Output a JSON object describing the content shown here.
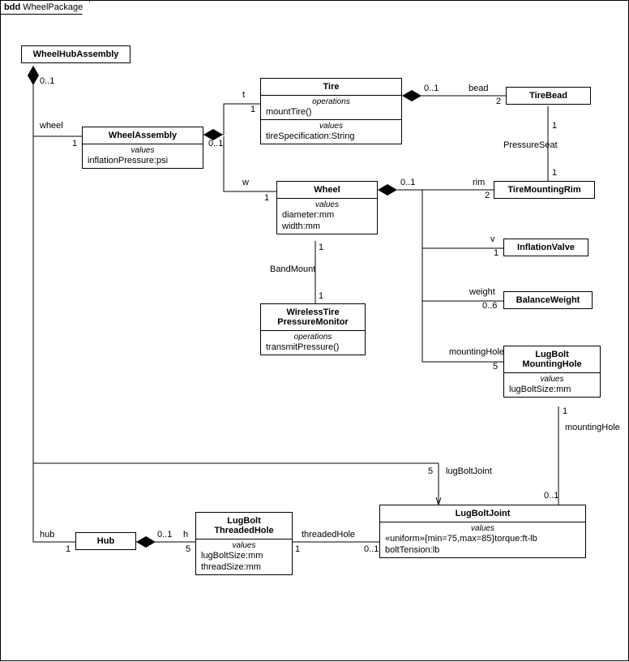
{
  "frame": {
    "prefix": "bdd",
    "name": "WheelPackage"
  },
  "blocks": {
    "wheelHubAssembly": {
      "title": "WheelHubAssembly"
    },
    "wheelAssembly": {
      "title": "WheelAssembly",
      "valuesCaption": "values",
      "values": [
        "inflationPressure:psi"
      ]
    },
    "tire": {
      "title": "Tire",
      "opsCaption": "operations",
      "ops": [
        "mountTire()"
      ],
      "valuesCaption": "values",
      "values": [
        "tireSpecification:String"
      ]
    },
    "tireBead": {
      "title": "TireBead"
    },
    "wheel": {
      "title": "Wheel",
      "valuesCaption": "values",
      "values": [
        "diameter:mm",
        "width:mm"
      ]
    },
    "tireMountingRim": {
      "title": "TireMountingRim"
    },
    "inflationValve": {
      "title": "InflationValve"
    },
    "balanceWeight": {
      "title": "BalanceWeight"
    },
    "wirelessMonitor": {
      "title": "WirelessTire\nPressureMonitor",
      "opsCaption": "operations",
      "ops": [
        "transmitPressure()"
      ]
    },
    "lugBoltMountingHole": {
      "title": "LugBolt\nMountingHole",
      "valuesCaption": "values",
      "values": [
        "lugBoltSize:mm"
      ]
    },
    "hub": {
      "title": "Hub"
    },
    "lugBoltThreadedHole": {
      "title": "LugBolt\nThreadedHole",
      "valuesCaption": "values",
      "values": [
        "lugBoltSize:mm",
        "threadSize:mm"
      ]
    },
    "lugBoltJoint": {
      "title": "LugBoltJoint",
      "valuesCaption": "values",
      "values": [
        "«uniform»{min=75,max=85}torque:ft-lb",
        "boltTension:lb"
      ]
    }
  },
  "labels": {
    "wheel": "wheel",
    "one": "1",
    "zeroOne": "0..1",
    "t": "t",
    "w": "w",
    "bead": "bead",
    "two": "2",
    "pressureSeat": "PressureSeat",
    "rim": "rim",
    "v": "v",
    "weight": "weight",
    "zeroSix": "0..6",
    "bandMount": "BandMount",
    "mountingHole": "mountingHole",
    "five": "5",
    "hub": "hub",
    "h": "h",
    "threadedHole": "threadedHole",
    "lugBoltJoint": "lugBoltJoint"
  }
}
